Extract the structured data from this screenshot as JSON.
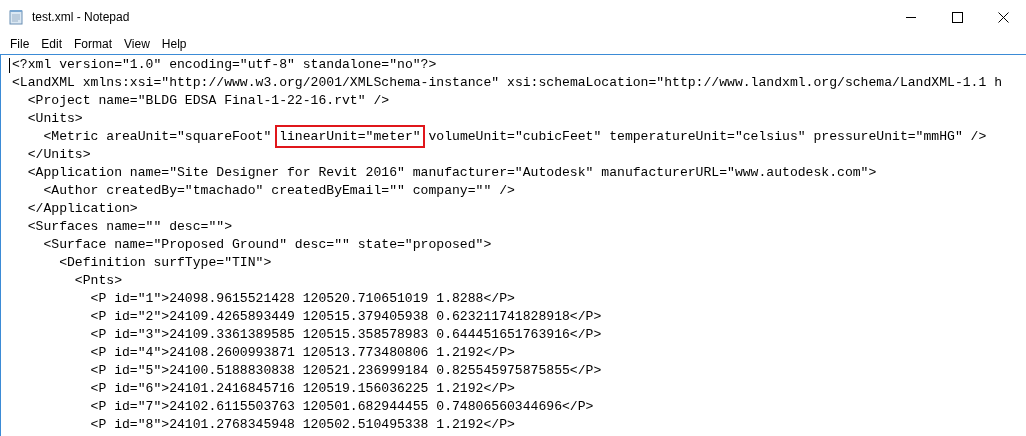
{
  "window": {
    "title": "test.xml - Notepad"
  },
  "menu": [
    {
      "label": "File"
    },
    {
      "label": "Edit"
    },
    {
      "label": "Format"
    },
    {
      "label": "View"
    },
    {
      "label": "Help"
    }
  ],
  "lines": [
    {
      "segments": [
        {
          "text": "<?xml version=\"1.0\" encoding=\"utf-8\" standalone=\"no\"?>",
          "highlighted": false
        }
      ]
    },
    {
      "segments": [
        {
          "text": "<LandXML xmlns:xsi=\"http://www.w3.org/2001/XMLSchema-instance\" xsi:schemaLocation=\"http://www.landxml.org/schema/LandXML-1.1 h",
          "highlighted": false
        }
      ],
      "children": [
        {
          "segments": [
            {
              "text": "<Project name=\"BLDG EDSA Final-1-22-16.rvt\" />",
              "highlighted": false
            }
          ]
        },
        {
          "segments": [
            {
              "text": "<Units>",
              "highlighted": false
            }
          ],
          "children": [
            {
              "segments": [
                {
                  "text": "<Metric areaUnit=\"squareFoot\" ",
                  "highlighted": false
                },
                {
                  "text": "linearUnit=\"meter\"",
                  "highlighted": true
                },
                {
                  "text": " volumeUnit=\"cubicFeet\" temperatureUnit=\"celsius\" pressureUnit=\"mmHG\" />",
                  "highlighted": false
                }
              ]
            }
          ]
        },
        {
          "segments": [
            {
              "text": "</Units>",
              "highlighted": false
            }
          ]
        },
        {
          "segments": [
            {
              "text": "<Application name=\"Site Designer for Revit 2016\" manufacturer=\"Autodesk\" manufacturerURL=\"www.autodesk.com\">",
              "highlighted": false
            }
          ],
          "children": [
            {
              "segments": [
                {
                  "text": "<Author createdBy=\"tmachado\" createdByEmail=\"\" company=\"\" />",
                  "highlighted": false
                }
              ]
            }
          ]
        },
        {
          "segments": [
            {
              "text": "</Application>",
              "highlighted": false
            }
          ]
        },
        {
          "segments": [
            {
              "text": "<Surfaces name=\"\" desc=\"\">",
              "highlighted": false
            }
          ],
          "children": [
            {
              "segments": [
                {
                  "text": "<Surface name=\"Proposed Ground\" desc=\"\" state=\"proposed\">",
                  "highlighted": false
                }
              ],
              "children": [
                {
                  "segments": [
                    {
                      "text": "<Definition surfType=\"TIN\">",
                      "highlighted": false
                    }
                  ],
                  "children": [
                    {
                      "segments": [
                        {
                          "text": "<Pnts>",
                          "highlighted": false
                        }
                      ],
                      "children": [
                        {
                          "segments": [
                            {
                              "text": "<P id=\"1\">24098.9615521428 120520.710651019 1.8288</P>",
                              "highlighted": false
                            }
                          ]
                        },
                        {
                          "segments": [
                            {
                              "text": "<P id=\"2\">24109.4265893449 120515.379405938 0.623211741828918</P>",
                              "highlighted": false
                            }
                          ]
                        },
                        {
                          "segments": [
                            {
                              "text": "<P id=\"3\">24109.3361389585 120515.358578983 0.644451651763916</P>",
                              "highlighted": false
                            }
                          ]
                        },
                        {
                          "segments": [
                            {
                              "text": "<P id=\"4\">24108.2600993871 120513.773480806 1.2192</P>",
                              "highlighted": false
                            }
                          ]
                        },
                        {
                          "segments": [
                            {
                              "text": "<P id=\"5\">24100.5188830838 120521.236999184 0.825545975875855</P>",
                              "highlighted": false
                            }
                          ]
                        },
                        {
                          "segments": [
                            {
                              "text": "<P id=\"6\">24101.2416845716 120519.156036225 1.2192</P>",
                              "highlighted": false
                            }
                          ]
                        },
                        {
                          "segments": [
                            {
                              "text": "<P id=\"7\">24102.6115503763 120501.682944455 0.74806560344696</P>",
                              "highlighted": false
                            }
                          ]
                        },
                        {
                          "segments": [
                            {
                              "text": "<P id=\"8\">24101.2768345948 120502.510495338 1.2192</P>",
                              "highlighted": false
                            }
                          ]
                        }
                      ]
                    }
                  ]
                }
              ]
            }
          ]
        }
      ]
    }
  ]
}
